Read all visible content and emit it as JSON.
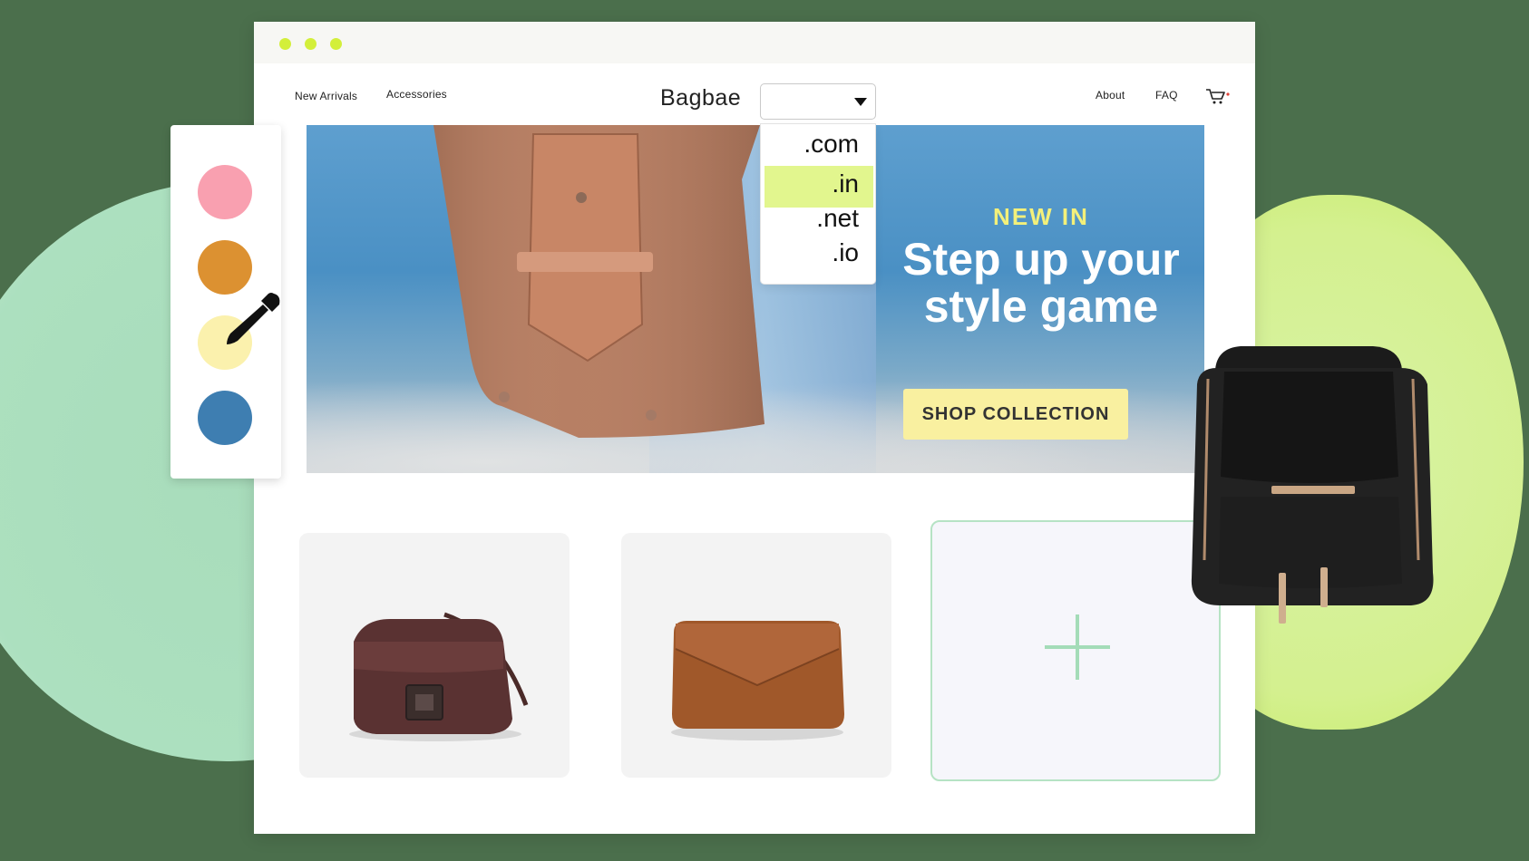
{
  "nav": {
    "left_links": [
      "New Arrivals",
      "Accessories"
    ],
    "brand": "Bagbae",
    "right_links": [
      "About",
      "FAQ"
    ],
    "cart_icon": "cart-icon"
  },
  "domain_select": {
    "value": "",
    "options": [
      ".com",
      ".in",
      ".net",
      ".io"
    ],
    "highlighted": ".in"
  },
  "hero": {
    "kicker": "NEW IN",
    "headline_line1": "Step up your",
    "headline_line2": "style game",
    "cta": "SHOP COLLECTION"
  },
  "palette": {
    "swatches": [
      "#f9a0b0",
      "#dc9131",
      "#fbf1ad",
      "#3e7eb1"
    ],
    "tool_icon": "eyedropper-icon"
  },
  "products": [
    {
      "icon": "crossbody-bag-image",
      "color": "#5a3232"
    },
    {
      "icon": "clutch-bag-image",
      "color": "#a0582a"
    }
  ],
  "add_card_icon": "plus-icon",
  "floating_item": "backpack-image",
  "colors": {
    "accent_lime": "#d3ef3a",
    "hero_kicker": "#f3f07a",
    "cta_bg": "#f9f0a0",
    "dropdown_highlight": "#e2f68e"
  }
}
